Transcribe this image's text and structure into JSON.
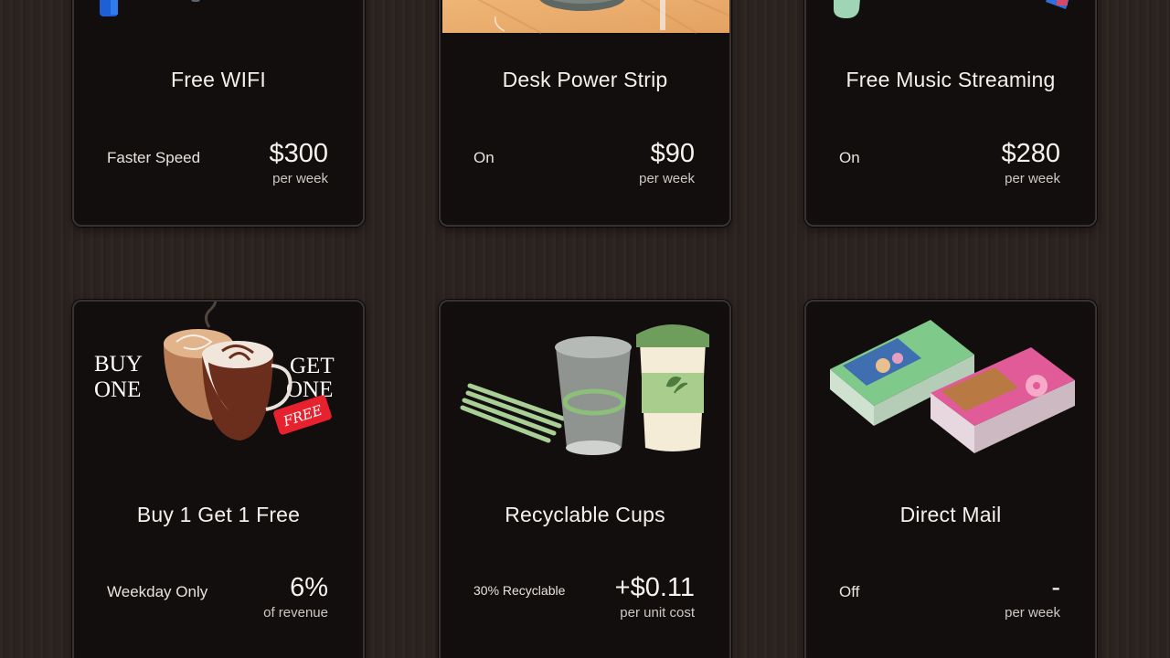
{
  "cards": [
    {
      "title": "Free WIFI",
      "option": "Faster Speed",
      "amount": "$300",
      "unit": "per week"
    },
    {
      "title": "Desk Power Strip",
      "option": "On",
      "amount": "$90",
      "unit": "per week"
    },
    {
      "title": "Free Music Streaming",
      "option": "On",
      "amount": "$280",
      "unit": "per week"
    },
    {
      "title": "Buy 1 Get 1 Free",
      "option": "Weekday Only",
      "amount": "6%",
      "unit": "of revenue",
      "art": {
        "left": "BUY ONE",
        "right": "GET ONE",
        "tag": "FREE"
      }
    },
    {
      "title": "Recyclable Cups",
      "option": "30% Recyclable",
      "amount": "+$0.11",
      "unit": "per unit cost"
    },
    {
      "title": "Direct Mail",
      "option": "Off",
      "amount": "-",
      "unit": "per week"
    }
  ]
}
